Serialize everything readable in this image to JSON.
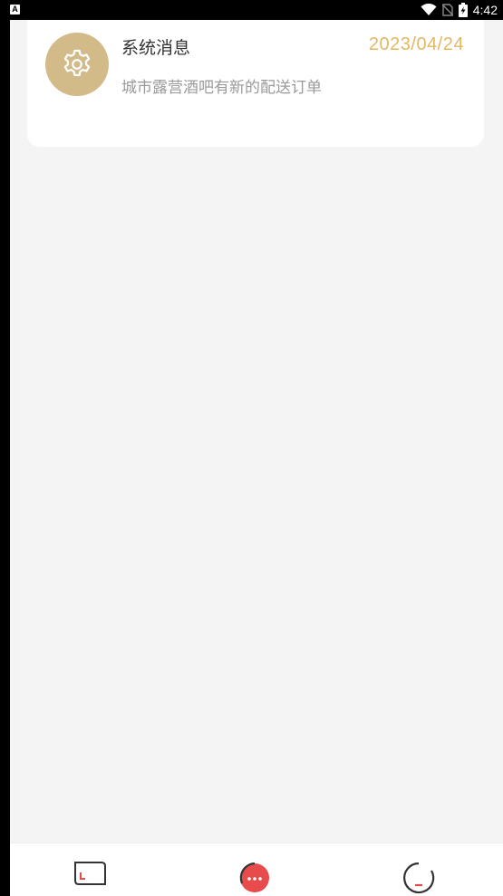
{
  "status_bar": {
    "app_indicator": "A",
    "time": "4:42"
  },
  "message": {
    "title": "系统消息",
    "date": "2023/04/24",
    "body": "城市露营酒吧有新的配送订单",
    "avatar_icon": "gear-icon",
    "avatar_color": "#d3bb89",
    "date_color": "#e3b863"
  },
  "tab_bar": {
    "tabs": [
      {
        "icon": "home-card-icon",
        "active": false
      },
      {
        "icon": "chat-bubble-icon",
        "active": true,
        "active_color": "#e84b4b"
      },
      {
        "icon": "profile-icon",
        "active": false
      }
    ]
  }
}
